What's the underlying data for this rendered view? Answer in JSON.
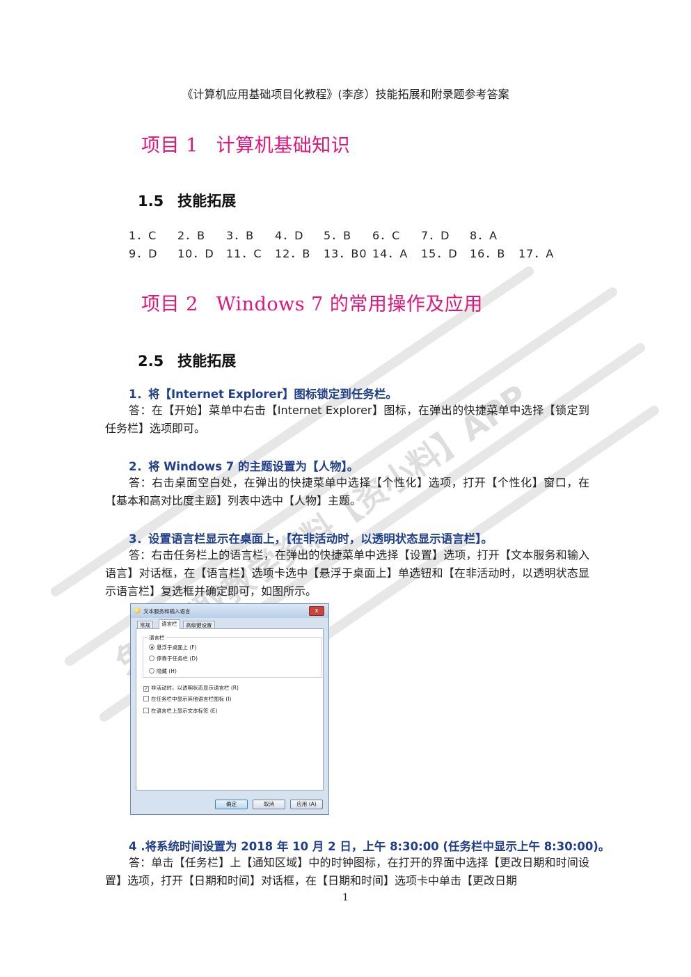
{
  "header": "《计算机应用基础项目化教程》(李彦）技能拓展和附录题参考答案",
  "chapters": [
    {
      "num": "项目 1",
      "title": "计算机基础知识"
    },
    {
      "num": "项目 2",
      "title": "Windows 7 的常用操作及应用"
    }
  ],
  "sections": [
    {
      "num": "1.5",
      "title": "技能拓展"
    },
    {
      "num": "2.5",
      "title": "技能拓展"
    }
  ],
  "answers": {
    "row1": [
      "1．C",
      "2．B",
      "3．B",
      "4．D",
      "5．B",
      "6．C",
      "7．D",
      "8．A"
    ],
    "row2": [
      "9．D",
      "10．D",
      "11．C",
      "12．B",
      "13．B0",
      "14．A",
      "15．D",
      "16．B",
      "17．A"
    ]
  },
  "questions": [
    {
      "q": "1．将【Internet Explorer】图标锁定到任务栏。",
      "a": "答：在【开始】菜单中右击【Internet Explorer】图标，在弹出的快捷菜单中选择【锁定到任务栏】选项即可。"
    },
    {
      "q": "2．将 Windows 7 的主题设置为【人物】。",
      "a": "答：右击桌面空白处，在弹出的快捷菜单中选择【个性化】选项，打开【个性化】窗口，在【基本和高对比度主题】列表中选中【人物】主题。"
    },
    {
      "q": "3．设置语言栏显示在桌面上，【在非活动时，以透明状态显示语言栏】。",
      "a": "答：右击任务栏上的语言栏，在弹出的快捷菜单中选择【设置】选项，打开【文本服务和输入语言】对话框，在【语言栏】选项卡选中【悬浮于桌面上】单选钮和【在非活动时，以透明状态显示语言栏】复选框并确定即可，如图所示。"
    },
    {
      "q": "4 .将系统时间设置为 2018 年 10 月 2 日，上午 8:30:00 (任务栏中显示上午 8:30:00)。",
      "a": "答：单击【任务栏】上【通知区域】中的时钟图标，在打开的界面中选择【更改日期和时间设置】选项，打开【日期和时间】对话框，在【日期和时间】选项卡中单击【更改日期"
    }
  ],
  "dialog": {
    "title": "文本服务和输入语言",
    "close": "x",
    "tabs": [
      "常规",
      "语言栏",
      "高级键设置"
    ],
    "group_label": "语言栏",
    "radios": [
      "悬浮于桌面上 (F)",
      "停靠于任务栏 (D)",
      "隐藏 (H)"
    ],
    "checks": [
      "非活动时，以透明状态显示语言栏 (R)",
      "在任务栏中显示其他语言栏图标 (I)",
      "在语言栏上显示文本标签 (E)"
    ],
    "buttons": [
      "确定",
      "取消",
      "应用 (A)"
    ]
  },
  "watermark": "免费获取教学资料【资小料】APP",
  "page_number": "1"
}
